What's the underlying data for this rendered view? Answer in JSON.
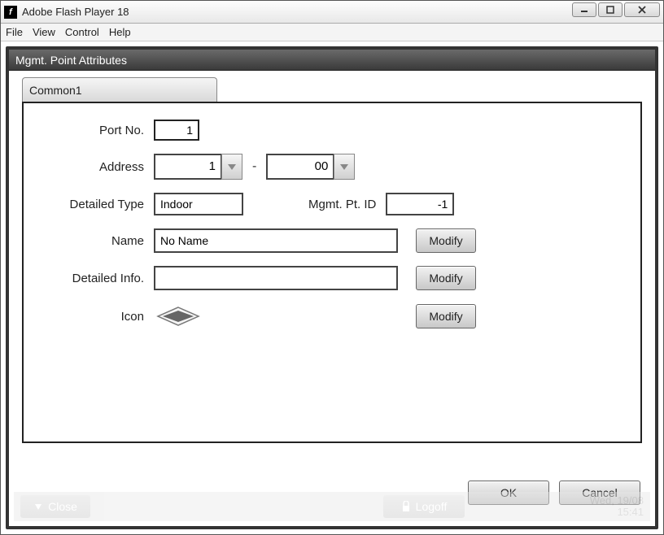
{
  "window": {
    "title": "Adobe Flash Player 18",
    "app_icon_letter": "f"
  },
  "menubar": {
    "file": "File",
    "view": "View",
    "control": "Control",
    "help": "Help"
  },
  "panel": {
    "header": "Mgmt. Point Attributes",
    "tab1": "Common1"
  },
  "form": {
    "port_label": "Port No.",
    "port_value": "1",
    "address_label": "Address",
    "address_a": "1",
    "address_dash": "-",
    "address_b": "00",
    "type_label": "Detailed Type",
    "type_value": "Indoor",
    "mgmt_id_label": "Mgmt. Pt. ID",
    "mgmt_id_value": "-1",
    "name_label": "Name",
    "name_value": "No Name",
    "info_label": "Detailed Info.",
    "info_value": "",
    "icon_label": "Icon",
    "modify": "Modify"
  },
  "dialog": {
    "ok": "OK",
    "cancel": "Cancel"
  },
  "footer": {
    "close": "Close",
    "logoff": "Logoff",
    "date": "Wed, 19/08",
    "time": "15:41"
  }
}
